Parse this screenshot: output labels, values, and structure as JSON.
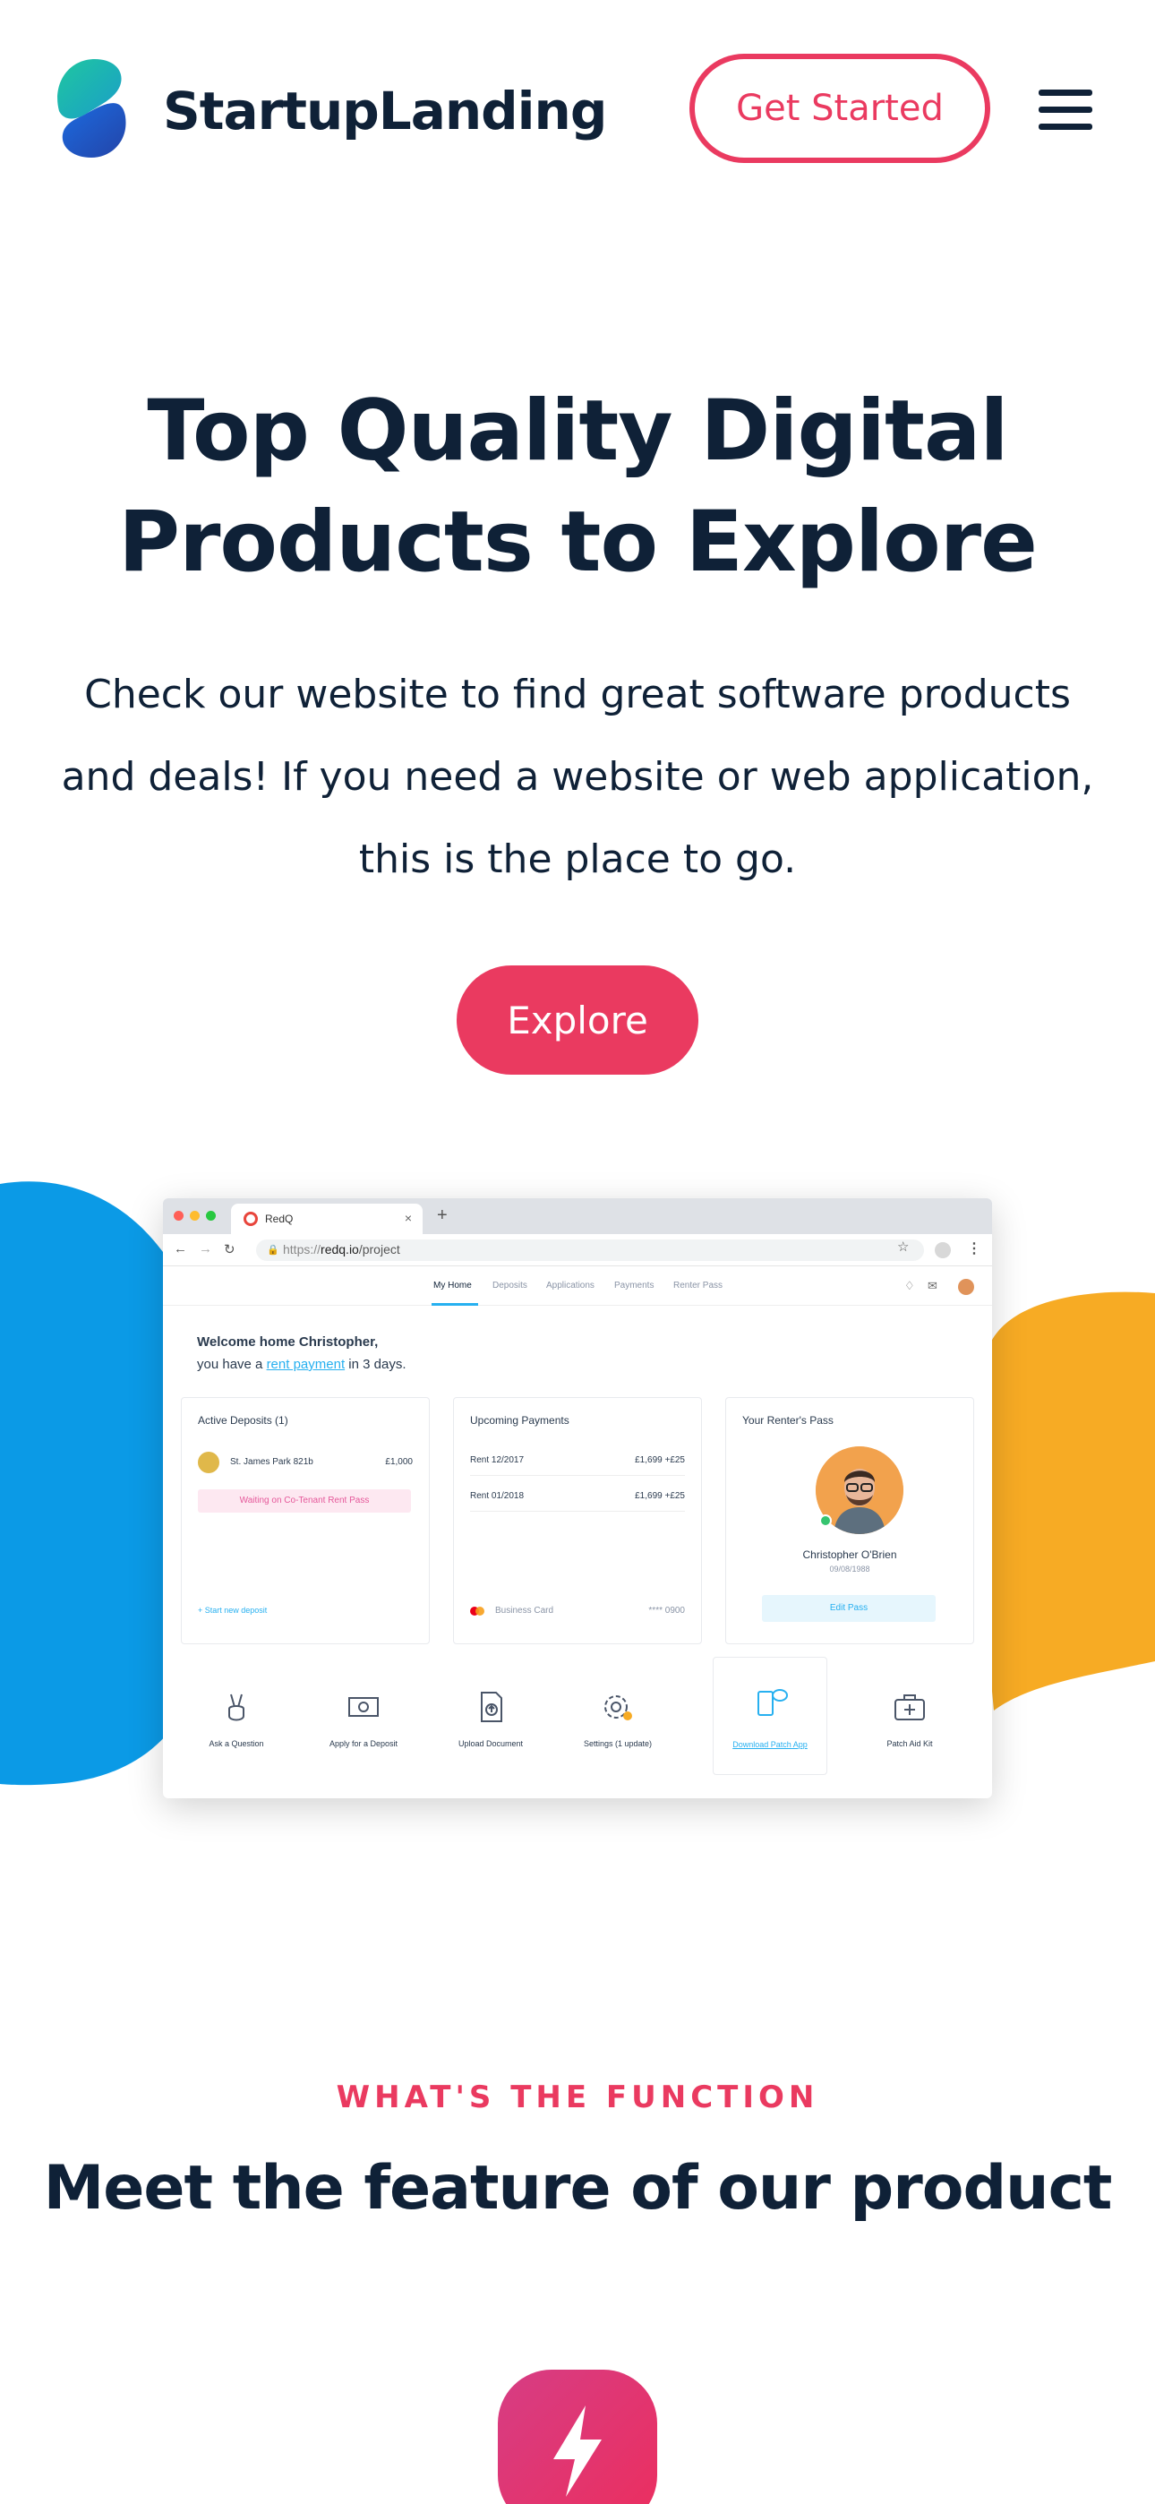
{
  "header": {
    "brand": "StartupLanding",
    "cta_label": "Get Started"
  },
  "hero": {
    "title_line1": "Top Quality Digital",
    "title_line2": "Products to Explore",
    "text_line1": "Check our website to find great software products",
    "text_line2": "and deals! If you need a website or web application,",
    "text_line3": "this is the place to go.",
    "cta_label": "Explore"
  },
  "mockup": {
    "tab_title": "RedQ",
    "url_prefix": "https://",
    "url_domain": "redq.io",
    "url_path": "/project",
    "nav": [
      "My Home",
      "Deposits",
      "Applications",
      "Payments",
      "Renter Pass"
    ],
    "welcome_line1": "Welcome home Christopher,",
    "welcome_pre": "you have a ",
    "welcome_link": "rent payment",
    "welcome_post": " in 3 days.",
    "deposits": {
      "title": "Active Deposits (1)",
      "address": "St. James Park 821b",
      "amount": "£1,000",
      "status": "Waiting on Co-Tenant Rent Pass",
      "link": "+ Start new deposit"
    },
    "payments": {
      "title": "Upcoming Payments",
      "rows": [
        {
          "label": "Rent 12/2017",
          "amount": "£1,699 +£25"
        },
        {
          "label": "Rent 01/2018",
          "amount": "£1,699 +£25"
        }
      ],
      "card_label": "Business Card",
      "card_number": "**** 0900"
    },
    "pass": {
      "title": "Your Renter's Pass",
      "name": "Christopher O'Brien",
      "date": "09/08/1988",
      "button": "Edit Pass"
    },
    "actions": [
      {
        "label": "Ask a Question",
        "icon": "peace-hand-icon"
      },
      {
        "label": "Apply for a Deposit",
        "icon": "money-icon"
      },
      {
        "label": "Upload Document",
        "icon": "document-upload-icon"
      },
      {
        "label": "Settings (1 update)",
        "icon": "gear-icon"
      },
      {
        "label": "Download Patch App",
        "icon": "phone-chat-icon"
      },
      {
        "label": "Patch Aid Kit",
        "icon": "first-aid-kit-icon"
      }
    ]
  },
  "features": {
    "eyebrow": "WHAT'S THE FUNCTION",
    "title": "Meet the feature of our product"
  },
  "colors": {
    "primary": "#ea3a60",
    "heading": "#0f2137",
    "blob_blue": "#0b9ae6",
    "blob_yellow": "#f7ab24",
    "link": "#27b0f0"
  }
}
